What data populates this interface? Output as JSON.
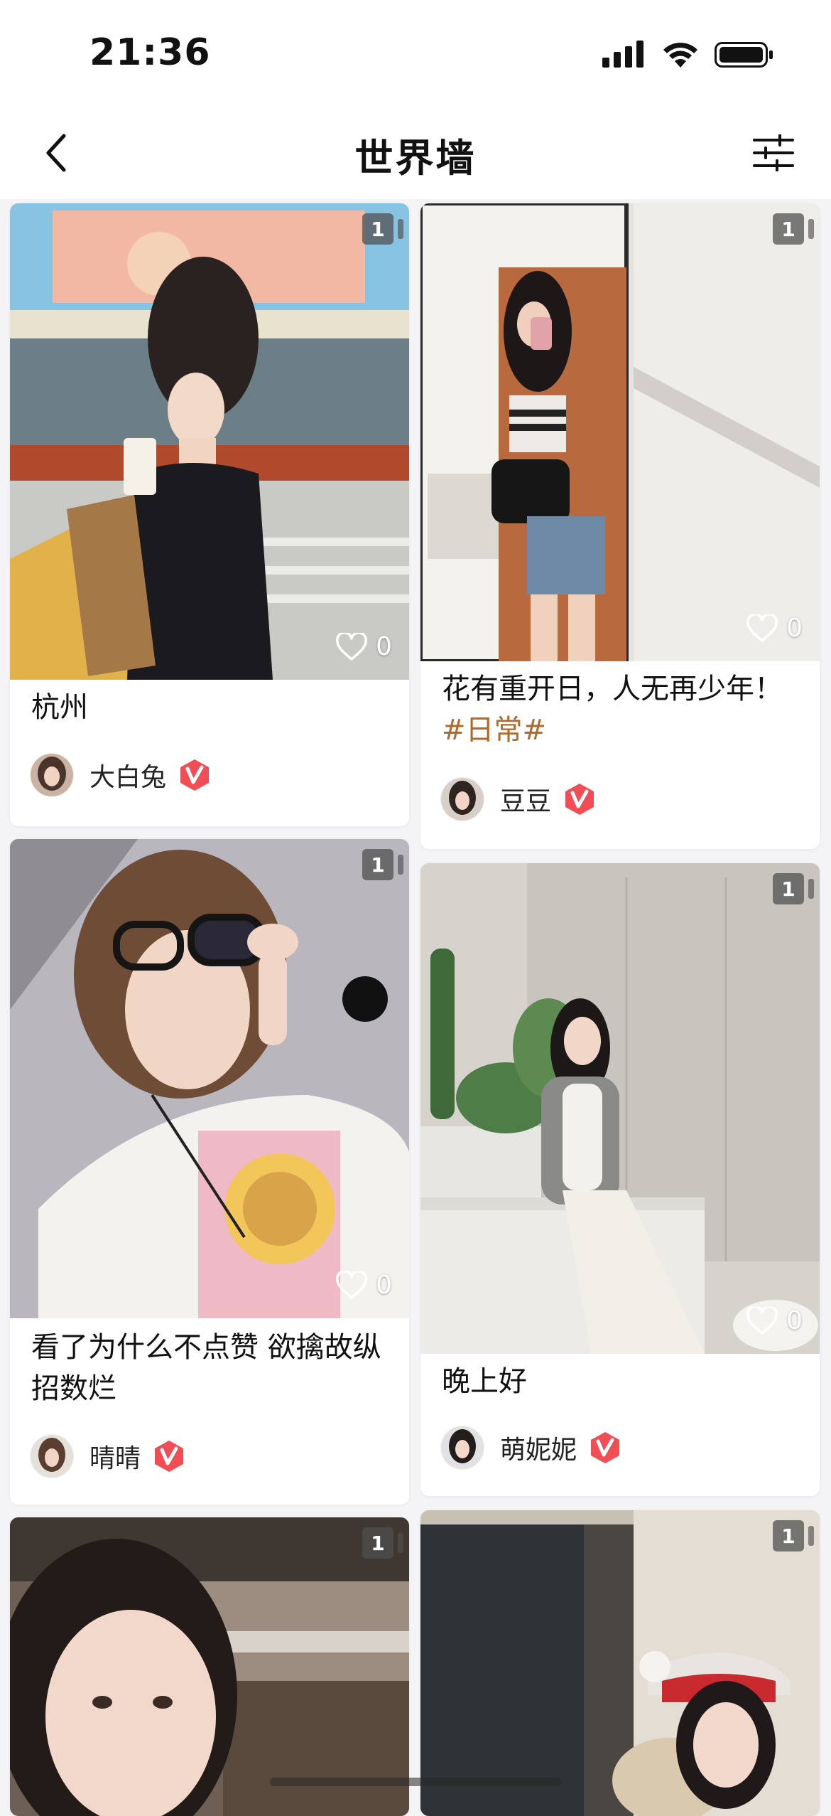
{
  "status_bar": {
    "time": "21:36"
  },
  "nav": {
    "title": "世界墙"
  },
  "icons": {
    "back": "chevron-left-icon",
    "filter": "sliders-icon",
    "like": "heart-outline-icon",
    "verified": "verified-v-badge-icon"
  },
  "colors": {
    "tag": "#b06a2c",
    "verified_badge": "#f04d55"
  },
  "feed": {
    "cards": [
      {
        "photo_count": "1",
        "likes": "0",
        "title": "杭州",
        "tag": "",
        "author": "大白兔"
      },
      {
        "photo_count": "1",
        "likes": "0",
        "title": "花有重开日，人无再少年！",
        "tag": "#日常#",
        "author": "豆豆"
      },
      {
        "photo_count": "1",
        "likes": "0",
        "title": "看了为什么不点赞 欲擒故纵招数烂",
        "tag": "",
        "author": "晴晴"
      },
      {
        "photo_count": "1",
        "likes": "0",
        "title": "晚上好",
        "tag": "",
        "author": "萌妮妮"
      },
      {
        "photo_count": "1"
      },
      {
        "photo_count": "1"
      }
    ]
  }
}
